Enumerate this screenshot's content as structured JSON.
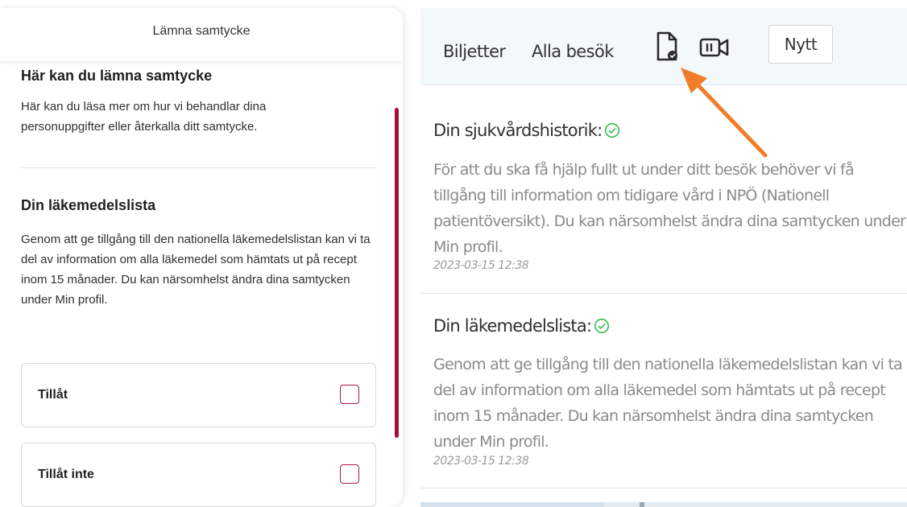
{
  "consent_modal": {
    "title": "Lämna samtycke",
    "intro": {
      "heading": "Här kan du lämna samtycke",
      "text": "Här kan du läsa mer om hur vi behandlar dina personuppgifter eller återkalla ditt samtycke."
    },
    "medication": {
      "heading": "Din läkemedelslista",
      "text": "Genom att ge tillgång till den nationella läkemedelslistan kan vi ta del av information om alla läkemedel som hämtats ut på recept inom 15 månader. Du kan närsomhelst ändra dina samtycken under Min profil."
    },
    "options": [
      {
        "label": "Tillåt",
        "checked": false
      },
      {
        "label": "Tillåt inte",
        "checked": false
      }
    ]
  },
  "nav": {
    "tickets": "Biljetter",
    "all_visits": "Alla besök",
    "document_icon": "document-check-icon",
    "video_icon": "video-camera-icon",
    "new_button": "Nytt"
  },
  "entries": [
    {
      "title": "Din sjukvårdshistorik:",
      "status_icon": "check-circle-icon",
      "text": "För att du ska få hjälp fullt ut under ditt besök behöver vi få tillgång till information om tidigare vård i NPÖ (Nationell patientöversikt). Du kan närsomhelst ändra dina samtycken under Min profil.",
      "date": "2023-03-15 12:38"
    },
    {
      "title": "Din läkemedelslista:",
      "status_icon": "check-circle-icon",
      "text": "Genom att ge tillgång till den nationella läkemedelslistan kan vi ta del av information om alla läkemedel som hämtats ut på recept inom 15 månader. Du kan närsomhelst ändra dina samtycken under Min profil.",
      "date": "2023-03-15 12:38"
    }
  ],
  "colors": {
    "brand_red": "#a60e3a",
    "check_green": "#2fbf4f",
    "annotation_arrow": "#f07d2a",
    "topbar_bg": "#f3f8fb"
  }
}
